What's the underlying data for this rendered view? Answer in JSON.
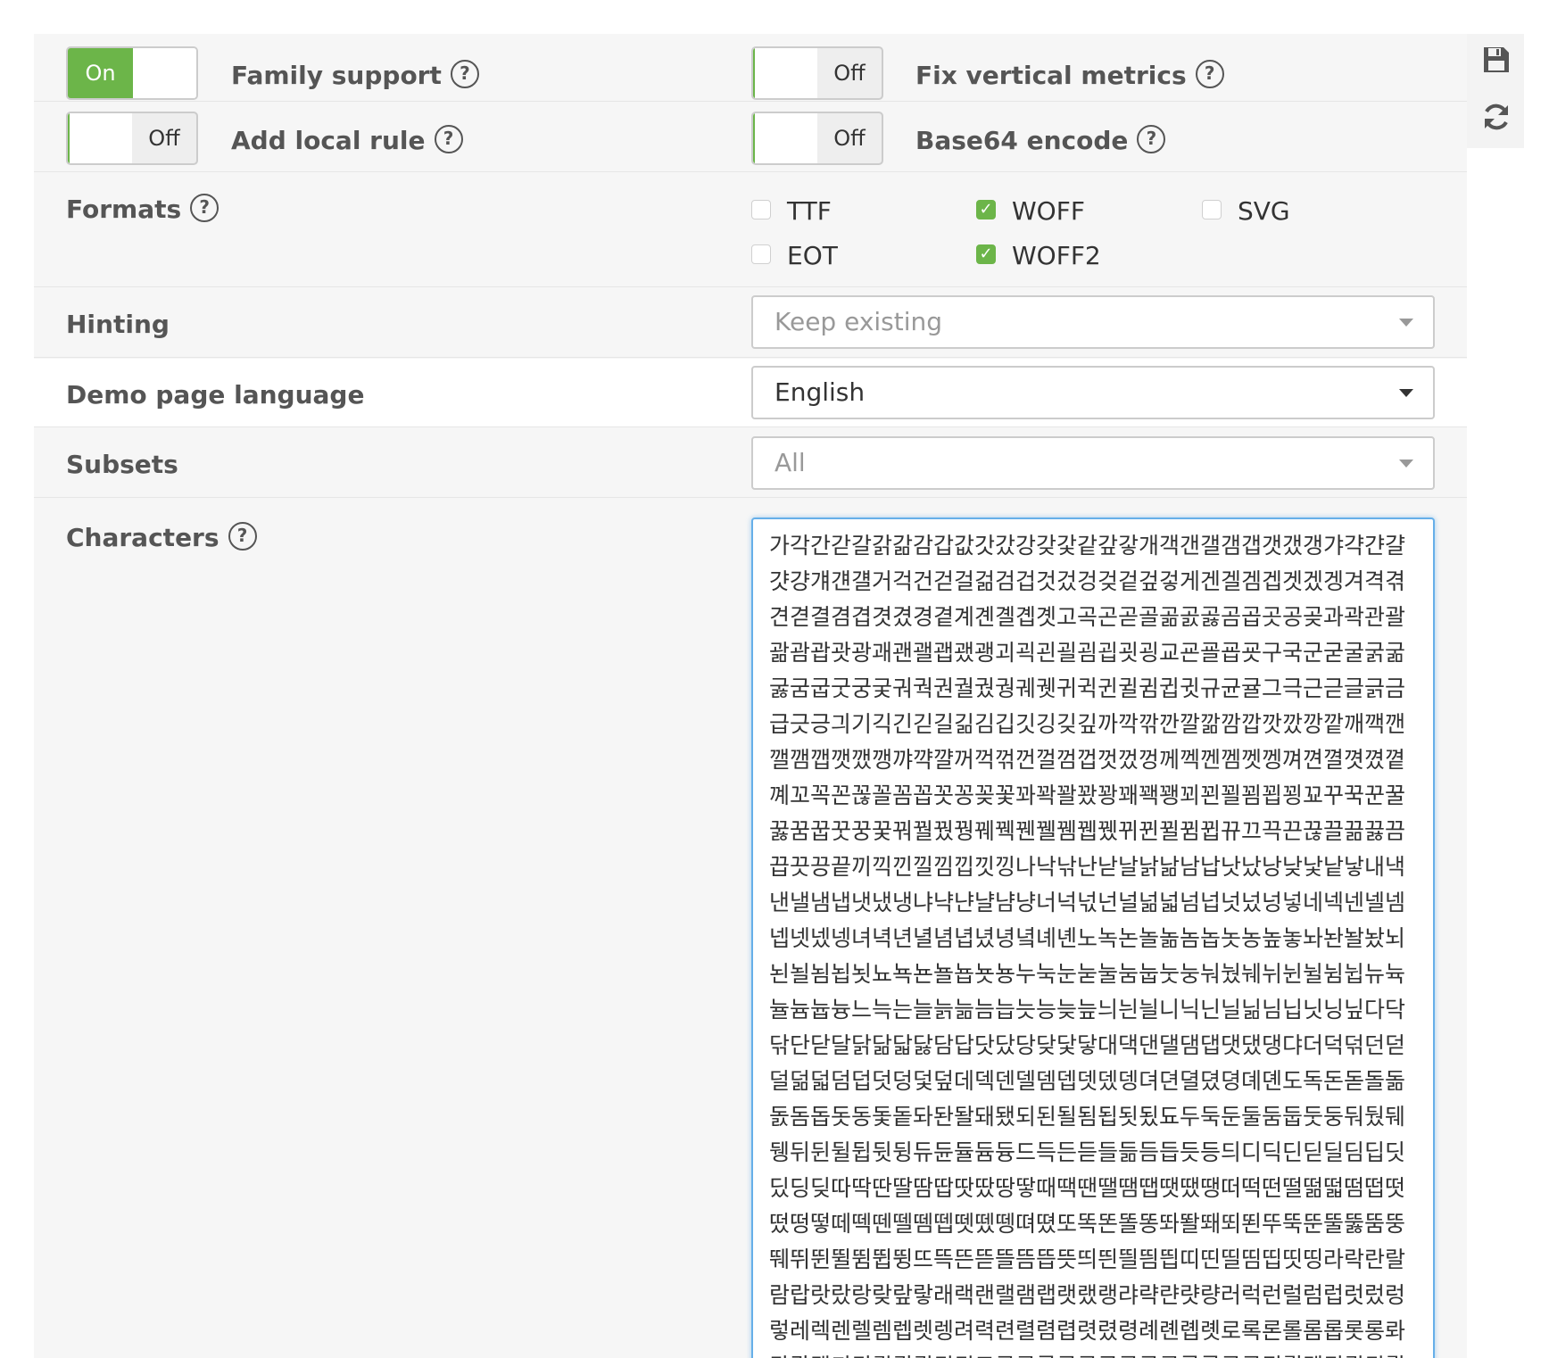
{
  "options": {
    "family_support": {
      "label": "Family support",
      "state": "On"
    },
    "fix_vertical_metrics": {
      "label": "Fix vertical metrics",
      "state": "Off"
    },
    "add_local_rule": {
      "label": "Add local rule",
      "state": "Off"
    },
    "base64_encode": {
      "label": "Base64 encode",
      "state": "Off"
    },
    "help_glyph": "?"
  },
  "formats": {
    "label": "Formats",
    "items": [
      {
        "label": "TTF",
        "checked": false
      },
      {
        "label": "WOFF",
        "checked": true
      },
      {
        "label": "SVG",
        "checked": false
      },
      {
        "label": "EOT",
        "checked": false
      },
      {
        "label": "WOFF2",
        "checked": true
      }
    ]
  },
  "hinting": {
    "label": "Hinting",
    "value": "Keep existing"
  },
  "demo_language": {
    "label": "Demo page language",
    "value": "English"
  },
  "subsets": {
    "label": "Subsets",
    "value": "All"
  },
  "characters": {
    "label": "Characters",
    "value": "가각간갇갈갉갊감갑값갓갔강갖갗같갚갛개객갠갤갬갭갯갰갱갸갹갼걀걋걍걔걘걜거걱건걷걸걺검겁것겄겅겆겉겊겋게겐겔겜겝겟겠겡겨격겪견겯결겸겹겻겼경곁계곈곌곕곗고곡곤곧골곪곬곯곰곱곳공곶과곽관괄괆괌괍괏광괘괜괠괩괬괭괴괵괸괼굄굅굇굉교굔굘굡굣구국군굳굴굵굶굻굼굽굿궁궂궈궉권궐궜궝궤궷귀귁귄귈귐귑귓규균귤그극근귿글긁금급긋긍긔기긱긴긷길긺김깁깃깅깆깊까깍깎깐깔깖깜깝깟깠깡깥깨깩깬깰깸깹깻깼깽꺄꺅꺌꺼꺽꺾껀껄껌껍껏껐껑께껙껜껨껫껭껴껸껼꼇꼈꼍꼐꼬꼭꼰꼲꼴꼼꼽꼿꽁꽂꽃꽈꽉꽐꽜꽝꽤꽥꽹꾀꾄꾈꾐꾑꾕꾜꾸꾹꾼꿀꿇꿈꿉꿋꿍꿎꿔꿜꿨꿩꿰꿱꿴꿸뀀뀁뀄뀌뀐뀔뀜뀝뀨끄끅끈끊끌끎끓끔끕끗끙끝끼끽낀낄낌낍낏낑나낙낚난낟날낡낢남납낫났낭낮낯낱낳내낵낸낼냄냅냇냈냉냐냑냔냘냠냥너넉넋넌널넒넓넘넙넛넜넝넣네넥넨넬넴넵넷넸넹녀녁년녈념녑녔녕녘녜녠노녹논놀놂놈놉놋농높놓놔놘놜놨뇌뇐뇔뇜뇝뇟뇨뇩뇬뇰뇹뇻뇽누눅눈눋눌눔눕눗눙눠눴눼뉘뉜뉠뉨뉩뉴뉵뉼늄늅늉느늑는늘늙늚늠늡늣능늦늪늬늰늴니닉닌닐닒님닙닛닝닢다닥닦단닫달닭닮닯닳담답닷닸당닺닻닿대댁댄댈댐댑댓댔댕댜더덕덖던덛덜덞덟덤덥덧덩덫덮데덱덴델뎀뎁뎃뎄뎅뎌뎐뎔뎠뎡뎨뎬도독돈돋돌돎돐돔돕돗동돛돝돠돤돨돼됐되된될됨됩됫됬됴두둑둔둘둠둡둣둥둬뒀뒈뒝뒤뒨뒬뒵뒷뒹듀듄듈듐듕드득든듣들듦듬듭듯등듸디딕딘딛딜딤딥딧딨딩딪따딱딴딸땀땁땃땄땅땋때땍땐땔땜땝땟땠땡떠떡떤떨떪떫떰떱떳떴떵떻떼떽뗀뗄뗌뗍뗏뗐뗑뗘뗬또똑똔똘똥똬똴뙈뙤뙨뚜뚝뚠뚤뚫뚬뚱뛔뛰뛴뛸뜀뜁뜅뜨뜩뜬뜯뜰뜸뜹뜻띄띈띌띔띕띠띤띨띰띱띳띵라락란랄람랍랏랐랑랒랖랗래랙랜랠램랩랫랬랭랴략랸럇량러럭런럴럼럽럿렀렁렇레렉렌렐렘렙렛렝려력련렬렴렵렷렸령례롄롑롓로록론롤롬롭롯롱롸롼뢍뢨뢰뢴뢸룀룁룃룅료룐룔룝룟룡루룩룬룰룸룹룻룽뤄뤘뤠뤼뤽륀륄륌륏륑류륙륜률륨륩륫륭르륵른를름릅릇릉릊릍릎리릭린릴림립릿링마막만많맏말맑맒맘맙맛망맞맡맣매맥맨맬맴맵맷맸맹맺먀먁먈먕머먹먼멀멂멈멉멋멍멎멓메멕멘멜멤멥멧멨멩며멱면멸몃몄명몇몌모목몫몬몰몲몸몹못몽뫄뫈뫘뫙뫼묀묄묍묏묑묘묜묠묩묫무묵묶문묻물묽묾뭄뭅뭇뭉뭍뭏뭐뭔뭘뭡뭣뭬뮈뮌뮐뮤뮨뮬뮴뮷므믄믈믐믓미믹민믿밀밂밈밉밋밌밍및밑"
  }
}
